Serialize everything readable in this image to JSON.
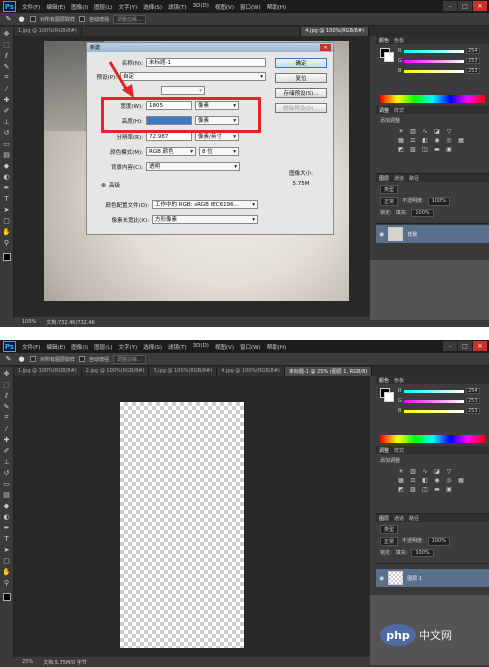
{
  "app": {
    "logo": "Ps"
  },
  "menu": [
    "文件(F)",
    "编辑(E)",
    "图像(I)",
    "图层(L)",
    "文字(Y)",
    "选择(S)",
    "滤镜(T)",
    "3D(D)",
    "视图(V)",
    "窗口(W)",
    "帮助(H)"
  ],
  "window_buttons": {
    "min": "–",
    "max": "□",
    "close": "✕"
  },
  "options_bar": {
    "sample_all": "对所有图层取样",
    "auto_enhance": "自动增强",
    "refine_edge": "调整边缘..."
  },
  "shot1": {
    "tabs": [
      "1.jpg @ 100%(RGB/8#)",
      "",
      "",
      "4.jpg @ 100%(RGB/8#)"
    ],
    "status": {
      "zoom": "100%",
      "doc": "文档:732.4K/732.4K"
    },
    "dialog": {
      "title": "新建",
      "name_label": "名称(N):",
      "name_value": "未标题-1",
      "preset_label": "预设(P):",
      "preset_value": "自定",
      "width_label": "宽度(W):",
      "width_value": "1805",
      "width_unit": "像素",
      "height_label": "高度(H):",
      "height_value": "3000",
      "height_unit": "像素",
      "resolution_label": "分辨率(R):",
      "resolution_value": "72.987",
      "resolution_unit": "像素/英寸",
      "colormode_label": "颜色模式(M):",
      "colormode_value": "RGB 颜色",
      "bitdepth_value": "8 位",
      "background_label": "背景内容(C):",
      "background_value": "透明",
      "advanced_label": "高级",
      "profile_label": "颜色配置文件(O):",
      "profile_value": "工作中的 RGB: sRGB IEC6196...",
      "aspect_label": "像素长宽比(X):",
      "aspect_value": "方形像素",
      "btn_ok": "确定",
      "btn_reset": "复位",
      "btn_save_preset": "存储预设(S)...",
      "btn_delete_preset": "删除预设(D)...",
      "image_size_label": "图像大小:",
      "image_size_value": "5.75M"
    },
    "layer_name": "背景"
  },
  "shot2": {
    "tabs": [
      "1.jpg @ 100%(RGB/8#)",
      "2.jpg @ 100%(RGB/8#)",
      "3.jpg @ 100%(RGB/8#)",
      "4.jpg @ 100%(RGB/8#)",
      "未标题-1 @ 25% (图层 1, RGB/8)"
    ],
    "status": {
      "zoom": "25%",
      "doc": "文档:5.75M/0 字节"
    },
    "layer_name": "图层 1",
    "adjust_title": "添加调整"
  },
  "panels": {
    "color_tabs": [
      "颜色",
      "色板"
    ],
    "adjust_tabs": [
      "调整",
      "样式"
    ],
    "adjust_title": "添加调整",
    "layer_tabs": [
      "图层",
      "通道",
      "路径"
    ],
    "kind_label": "类型",
    "blend_mode": "正常",
    "opacity_label": "不透明度:",
    "opacity_value": "100%",
    "lock_label": "锁定:",
    "fill_label": "填充:",
    "fill_value": "100%",
    "channels": [
      {
        "name": "R",
        "value": "254"
      },
      {
        "name": "G",
        "value": "253"
      },
      {
        "name": "B",
        "value": "253"
      }
    ]
  },
  "watermark": {
    "logo": "php",
    "text": "中文网"
  },
  "colors": {
    "accent": "#e42525",
    "selection": "#3b78c6"
  },
  "icons": [
    "ps-logo-icon",
    "move-icon",
    "marquee-icon",
    "lasso-icon",
    "quick-select-icon",
    "crop-icon",
    "eyedropper-icon",
    "healing-icon",
    "brush-icon",
    "stamp-icon",
    "history-brush-icon",
    "eraser-icon",
    "gradient-icon",
    "blur-icon",
    "dodge-icon",
    "pen-icon",
    "type-icon",
    "path-select-icon",
    "shape-icon",
    "hand-icon",
    "zoom-icon",
    "eye-icon",
    "red-arrow-icon"
  ]
}
